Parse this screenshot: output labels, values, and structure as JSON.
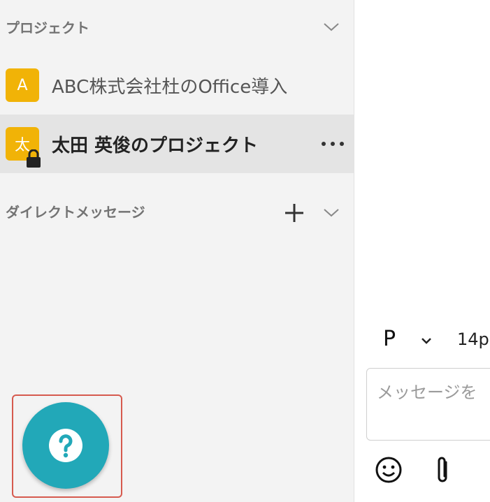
{
  "sidebar": {
    "projects_header": {
      "title": "プロジェクト",
      "chevron_icon": "chevron-down-icon"
    },
    "projects": [
      {
        "avatar": "A",
        "label": "ABC株式会社杜のOffice導入",
        "active": false
      },
      {
        "avatar": "太",
        "label": "太田 英俊のプロジェクト",
        "active": true,
        "locked": true,
        "more_icon": "more-horizontal-icon"
      }
    ],
    "dm_header": {
      "title": "ダイレクトメッセージ",
      "add_icon": "plus-icon",
      "chevron_icon": "chevron-down-icon"
    },
    "help_button": {
      "icon": "help-question-icon",
      "highlight_color": "#d65a4e",
      "color": "#22a8b8"
    }
  },
  "composer": {
    "format_label": "P",
    "font_size": "14p",
    "placeholder": "メッセージを",
    "emoji_icon": "smiley-icon",
    "attach_icon": "paperclip-icon"
  },
  "colors": {
    "avatar": "#f1b307",
    "sidebar_bg": "#f3f3f3",
    "active_bg": "#e4e4e4"
  }
}
